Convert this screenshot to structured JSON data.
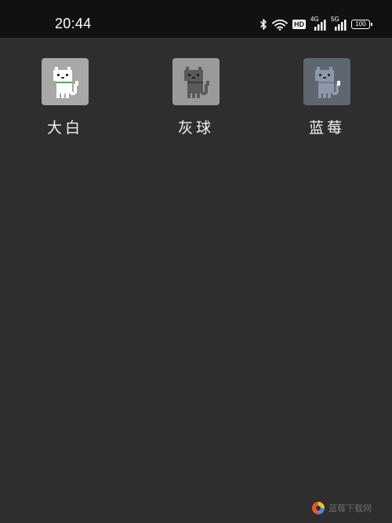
{
  "status_bar": {
    "time": "20:44",
    "hd_label": "HD",
    "network_1_label": "4G",
    "network_2_label": "5G",
    "battery_level": "100"
  },
  "apps": [
    {
      "label": "大白",
      "icon": "white-cat-icon",
      "tile_color": "#a8a8a8",
      "body_color": "#ffffff",
      "face_color": "#333333"
    },
    {
      "label": "灰球",
      "icon": "gray-cat-icon",
      "tile_color": "#9a9a9a",
      "body_color": "#5a5a5a",
      "face_color": "#222222"
    },
    {
      "label": "蓝莓",
      "icon": "blue-cat-icon",
      "tile_color": "#5e6670",
      "body_color": "#8c99a8",
      "face_color": "#2a2f36"
    }
  ],
  "watermark": {
    "text": "蓝莓下载网"
  },
  "colors": {
    "background": "#2e2e2e",
    "status_bar": "#111111",
    "label_text": "#f2f2f2"
  }
}
